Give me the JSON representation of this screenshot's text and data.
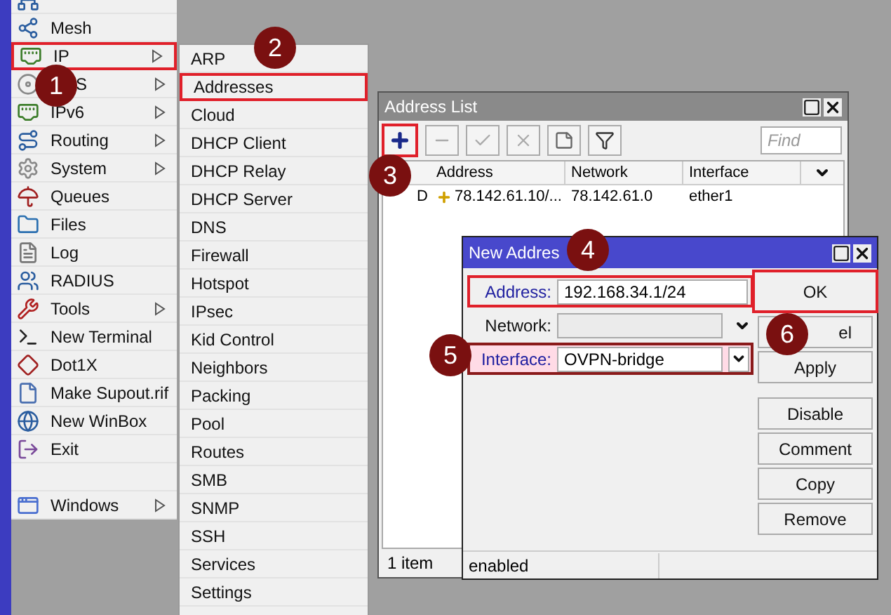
{
  "main_menu": {
    "items": [
      {
        "kind": "command",
        "label": "Mesh",
        "has_submenu": false,
        "highlighted": false
      },
      {
        "kind": "command",
        "label": "IP",
        "has_submenu": true,
        "highlighted": true
      },
      {
        "kind": "command",
        "label": "S",
        "has_submenu": true,
        "highlighted": false
      },
      {
        "kind": "command",
        "label": "IPv6",
        "has_submenu": true,
        "highlighted": false
      },
      {
        "kind": "command",
        "label": "Routing",
        "has_submenu": true,
        "highlighted": false
      },
      {
        "kind": "command",
        "label": "System",
        "has_submenu": true,
        "highlighted": false
      },
      {
        "kind": "command",
        "label": "Queues",
        "has_submenu": false,
        "highlighted": false
      },
      {
        "kind": "command",
        "label": "Files",
        "has_submenu": false,
        "highlighted": false
      },
      {
        "kind": "command",
        "label": "Log",
        "has_submenu": false,
        "highlighted": false
      },
      {
        "kind": "command",
        "label": "RADIUS",
        "has_submenu": false,
        "highlighted": false
      },
      {
        "kind": "command",
        "label": "Tools",
        "has_submenu": true,
        "highlighted": false
      },
      {
        "kind": "command",
        "label": "New Terminal",
        "has_submenu": false,
        "highlighted": false
      },
      {
        "kind": "command",
        "label": "Dot1X",
        "has_submenu": false,
        "highlighted": false
      },
      {
        "kind": "command",
        "label": "Make Supout.rif",
        "has_submenu": false,
        "highlighted": false
      },
      {
        "kind": "command",
        "label": "New WinBox",
        "has_submenu": false,
        "highlighted": false
      },
      {
        "kind": "command",
        "label": "Exit",
        "has_submenu": false,
        "highlighted": false
      },
      {
        "kind": "spacer"
      },
      {
        "kind": "command",
        "label": "Windows",
        "has_submenu": true,
        "highlighted": false
      }
    ]
  },
  "submenu": {
    "items": [
      {
        "label": "ARP",
        "highlighted": false
      },
      {
        "label": "Addresses",
        "highlighted": true
      },
      {
        "label": "Cloud",
        "highlighted": false
      },
      {
        "label": "DHCP Client",
        "highlighted": false
      },
      {
        "label": "DHCP Relay",
        "highlighted": false
      },
      {
        "label": "DHCP Server",
        "highlighted": false
      },
      {
        "label": "DNS",
        "highlighted": false
      },
      {
        "label": "Firewall",
        "highlighted": false
      },
      {
        "label": "Hotspot",
        "highlighted": false
      },
      {
        "label": "IPsec",
        "highlighted": false
      },
      {
        "label": "Kid Control",
        "highlighted": false
      },
      {
        "label": "Neighbors",
        "highlighted": false
      },
      {
        "label": "Packing",
        "highlighted": false
      },
      {
        "label": "Pool",
        "highlighted": false
      },
      {
        "label": "Routes",
        "highlighted": false
      },
      {
        "label": "SMB",
        "highlighted": false
      },
      {
        "label": "SNMP",
        "highlighted": false
      },
      {
        "label": "SSH",
        "highlighted": false
      },
      {
        "label": "Services",
        "highlighted": false
      },
      {
        "label": "Settings",
        "highlighted": false
      }
    ]
  },
  "address_list": {
    "title": "Address List",
    "add_highlighted": true,
    "find_placeholder": "Find",
    "columns": [
      "Address",
      "Network",
      "Interface"
    ],
    "rows": [
      {
        "flag": "D",
        "address": "78.142.61.10/...",
        "network": "78.142.61.0",
        "interface": "ether1"
      }
    ],
    "status": "1 item"
  },
  "new_address": {
    "title": "New Addres",
    "fields": [
      {
        "kind": "text",
        "label": "Address:",
        "value": "192.168.34.1/24",
        "highlighted": true,
        "enabled": true
      },
      {
        "kind": "dropdown",
        "label": "Network:",
        "highlighted": false,
        "enabled": false
      },
      {
        "kind": "select",
        "label": "Interface:",
        "value": "OVPN-bridge",
        "highlighted": true,
        "enabled": true
      }
    ],
    "buttons": [
      {
        "label": "OK",
        "highlighted": true
      },
      {
        "label": "el",
        "highlighted": false
      },
      {
        "label": "Apply",
        "highlighted": false
      },
      {
        "label": "Disable",
        "highlighted": false
      },
      {
        "label": "Comment",
        "highlighted": false
      },
      {
        "label": "Copy",
        "highlighted": false
      },
      {
        "label": "Remove",
        "highlighted": false
      }
    ],
    "status": "enabled"
  },
  "markers": [
    "1",
    "2",
    "3",
    "4",
    "5",
    "6"
  ]
}
